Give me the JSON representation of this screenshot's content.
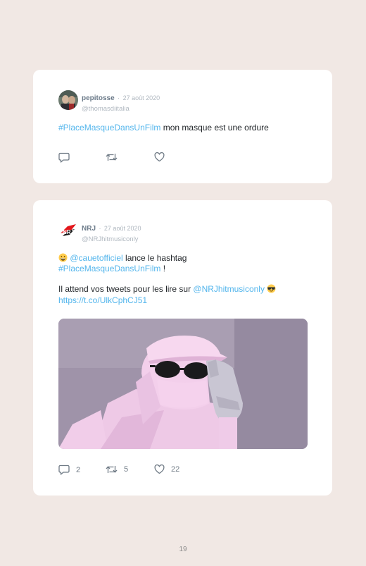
{
  "tweets": [
    {
      "name": "pepitosse",
      "separator": "·",
      "date": "27 août 2020",
      "handle": "@thomasdiitalia",
      "hashtag": "#PlaceMasqueDansUnFilm",
      "text_rest": " mon masque est une ordure"
    },
    {
      "name": "NRJ",
      "separator": "·",
      "date": "27 août 2020",
      "handle": "@NRJhitmusiconly",
      "logo_text": "NRJ",
      "mention": "@cauetofficiel",
      "line1_rest": " lance le hashtag",
      "hashtag": "#PlaceMasqueDansUnFilm",
      "line2_rest": " !",
      "line3_text": "Il attend vos tweets pour les lire sur ",
      "mention2": "@NRJhitmusiconly",
      "url": "https://t.co/UlkCphCJ51",
      "reply_count": "2",
      "retweet_count": "5",
      "like_count": "22"
    }
  ],
  "icons": {
    "reply": "reply-icon",
    "retweet": "retweet-icon",
    "like": "heart-icon",
    "emoji1": "grinning-face-emoji-icon",
    "emoji2": "sunglasses-face-emoji-icon"
  },
  "colors": {
    "background": "#f1e8e4",
    "card": "#ffffff",
    "link": "#52b5ec",
    "name": "#6b7a89",
    "muted": "#b0b8c0",
    "icon": "#6f7a85"
  },
  "page_number": "19"
}
